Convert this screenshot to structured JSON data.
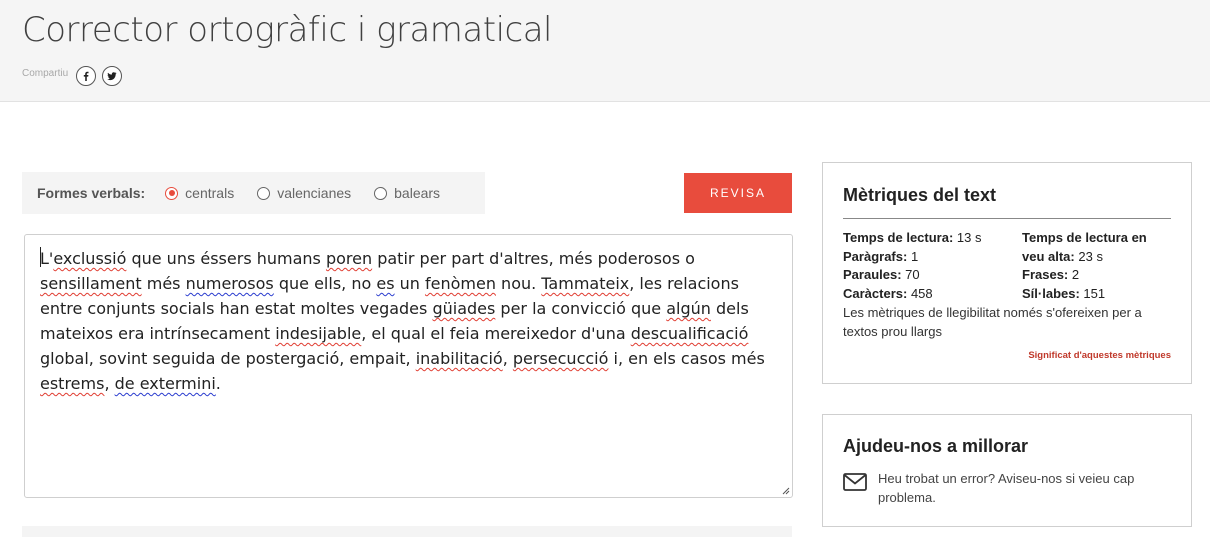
{
  "header": {
    "title": "Corrector ortogràfic i gramatical",
    "share_label": "Compartiu",
    "social": [
      {
        "name": "facebook-icon",
        "glyph": "f"
      },
      {
        "name": "twitter-icon",
        "glyph": "twitter"
      }
    ]
  },
  "options": {
    "label": "Formes verbals:",
    "choices": [
      {
        "label": "centrals",
        "selected": true
      },
      {
        "label": "valencianes",
        "selected": false
      },
      {
        "label": "balears",
        "selected": false
      }
    ]
  },
  "revisa_label": "REVISA",
  "editor": {
    "segments": [
      {
        "t": "L'"
      },
      {
        "t": "exclussió",
        "u": "err"
      },
      {
        "t": " que uns éssers humans "
      },
      {
        "t": "poren",
        "u": "err"
      },
      {
        "t": " patir per part d'altres, més poderosos o "
      },
      {
        "t": "sensillament",
        "u": "err"
      },
      {
        "t": " més "
      },
      {
        "t": "numerosos",
        "u": "gram"
      },
      {
        "t": " que ells, no "
      },
      {
        "t": "es",
        "u": "gram"
      },
      {
        "t": " un "
      },
      {
        "t": "fenòmen",
        "u": "err"
      },
      {
        "t": " nou. "
      },
      {
        "t": "Tammateix",
        "u": "err"
      },
      {
        "t": ", les relacions entre conjunts socials han estat moltes vegades "
      },
      {
        "t": "güiades",
        "u": "err"
      },
      {
        "t": " per la convicció que "
      },
      {
        "t": "algún",
        "u": "err"
      },
      {
        "t": " dels mateixos era intrínsecament "
      },
      {
        "t": "indesijable",
        "u": "err"
      },
      {
        "t": ", el qual el feia mereixedor d'una "
      },
      {
        "t": "descualificació",
        "u": "err"
      },
      {
        "t": " global, sovint seguida de postergació, empait, "
      },
      {
        "t": "inabilitació",
        "u": "err"
      },
      {
        "t": ", "
      },
      {
        "t": "persecucció",
        "u": "err"
      },
      {
        "t": " i, en els casos més "
      },
      {
        "t": "estrems",
        "u": "err"
      },
      {
        "t": ", "
      },
      {
        "t": "de extermini",
        "u": "typ"
      },
      {
        "t": "."
      }
    ]
  },
  "metrics": {
    "title": "Mètriques del text",
    "items": [
      {
        "label": "Temps de lectura:",
        "value": "13 s"
      },
      {
        "label": "Temps de lectura en veu alta:",
        "value": "23 s"
      },
      {
        "label": "Paràgrafs:",
        "value": "1"
      },
      {
        "label": "Paraules:",
        "value": "70"
      },
      {
        "label": "Frases:",
        "value": "2"
      },
      {
        "label": "Caràcters:",
        "value": "458"
      },
      {
        "label": "Síl·labes:",
        "value": "151"
      }
    ],
    "note": "Les mètriques de llegibilitat només s'ofereixen per a textos prou llargs",
    "link": "Significat d'aquestes mètriques"
  },
  "help": {
    "title": "Ajudeu-nos a millorar",
    "text": "Heu trobat un error? Aviseu-nos si veieu cap problema."
  },
  "colors": {
    "accent": "#e84c3d",
    "error_underline": "#e03c31",
    "grammar_underline": "#2a3ccf"
  }
}
